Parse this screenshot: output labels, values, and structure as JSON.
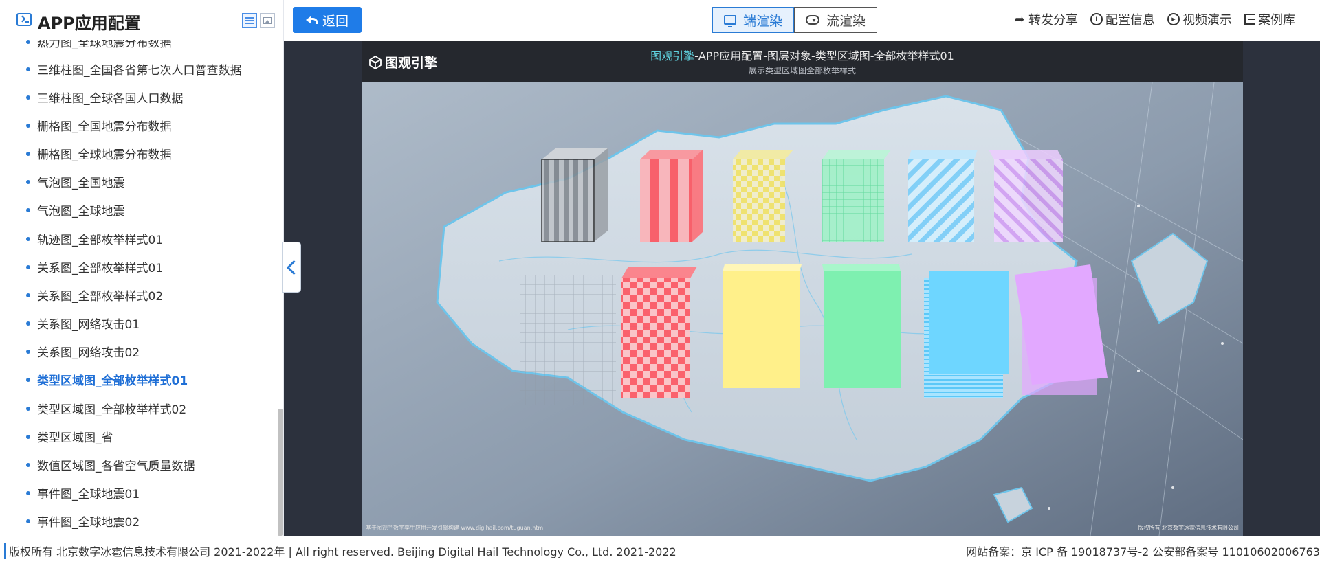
{
  "sidebar": {
    "title": "APP应用配置",
    "items": [
      {
        "label": "热力图_全球地震分布数据",
        "active": false
      },
      {
        "label": "三维柱图_全国各省第七次人口普查数据",
        "active": false
      },
      {
        "label": "三维柱图_全球各国人口数据",
        "active": false
      },
      {
        "label": "栅格图_全国地震分布数据",
        "active": false
      },
      {
        "label": "栅格图_全球地震分布数据",
        "active": false
      },
      {
        "label": "气泡图_全国地震",
        "active": false
      },
      {
        "label": "气泡图_全球地震",
        "active": false
      },
      {
        "label": "轨迹图_全部枚举样式01",
        "active": false
      },
      {
        "label": "关系图_全部枚举样式01",
        "active": false
      },
      {
        "label": "关系图_全部枚举样式02",
        "active": false
      },
      {
        "label": "关系图_网络攻击01",
        "active": false
      },
      {
        "label": "关系图_网络攻击02",
        "active": false
      },
      {
        "label": "类型区域图_全部枚举样式01",
        "active": true
      },
      {
        "label": "类型区域图_全部枚举样式02",
        "active": false
      },
      {
        "label": "类型区域图_省",
        "active": false
      },
      {
        "label": "数值区域图_各省空气质量数据",
        "active": false
      },
      {
        "label": "事件图_全球地震01",
        "active": false
      },
      {
        "label": "事件图_全球地震02",
        "active": false
      }
    ]
  },
  "toolbar": {
    "back_label": "返回",
    "render_client_label": "端渲染",
    "render_stream_label": "流渲染",
    "share_label": "转发分享",
    "config_label": "配置信息",
    "video_label": "视频演示",
    "library_label": "案例库"
  },
  "viewport": {
    "logo": "图观引擎",
    "title_highlight": "图观引擎",
    "title_rest": "-APP应用配置-图层对象-类型区域图-全部枚举样式01",
    "subtitle": "展示类型区域图全部枚举样式",
    "footer_left": "基于图观™数字孪生应用开发引擎构建 www.digihail.com/tuguan.html",
    "footer_right": "版权所有 北京数字冰雹信息技术有限公司"
  },
  "footer": {
    "copyright": "版权所有 北京数字冰雹信息技术有限公司 2021-2022年 | All right reserved. Beijing Digital Hail Technology Co., Ltd. 2021-2022",
    "record": "网站备案：京 ICP 备 19018737号-2 公安部备案号 11010602006763"
  },
  "colors": {
    "accent": "#2a7bd5",
    "stage_bg": "#2c313d",
    "block_colors": [
      "#c9c9c9",
      "#ff5a64",
      "#fff08a",
      "#7ef0b0",
      "#6ed6ff",
      "#e2a8ff"
    ]
  }
}
